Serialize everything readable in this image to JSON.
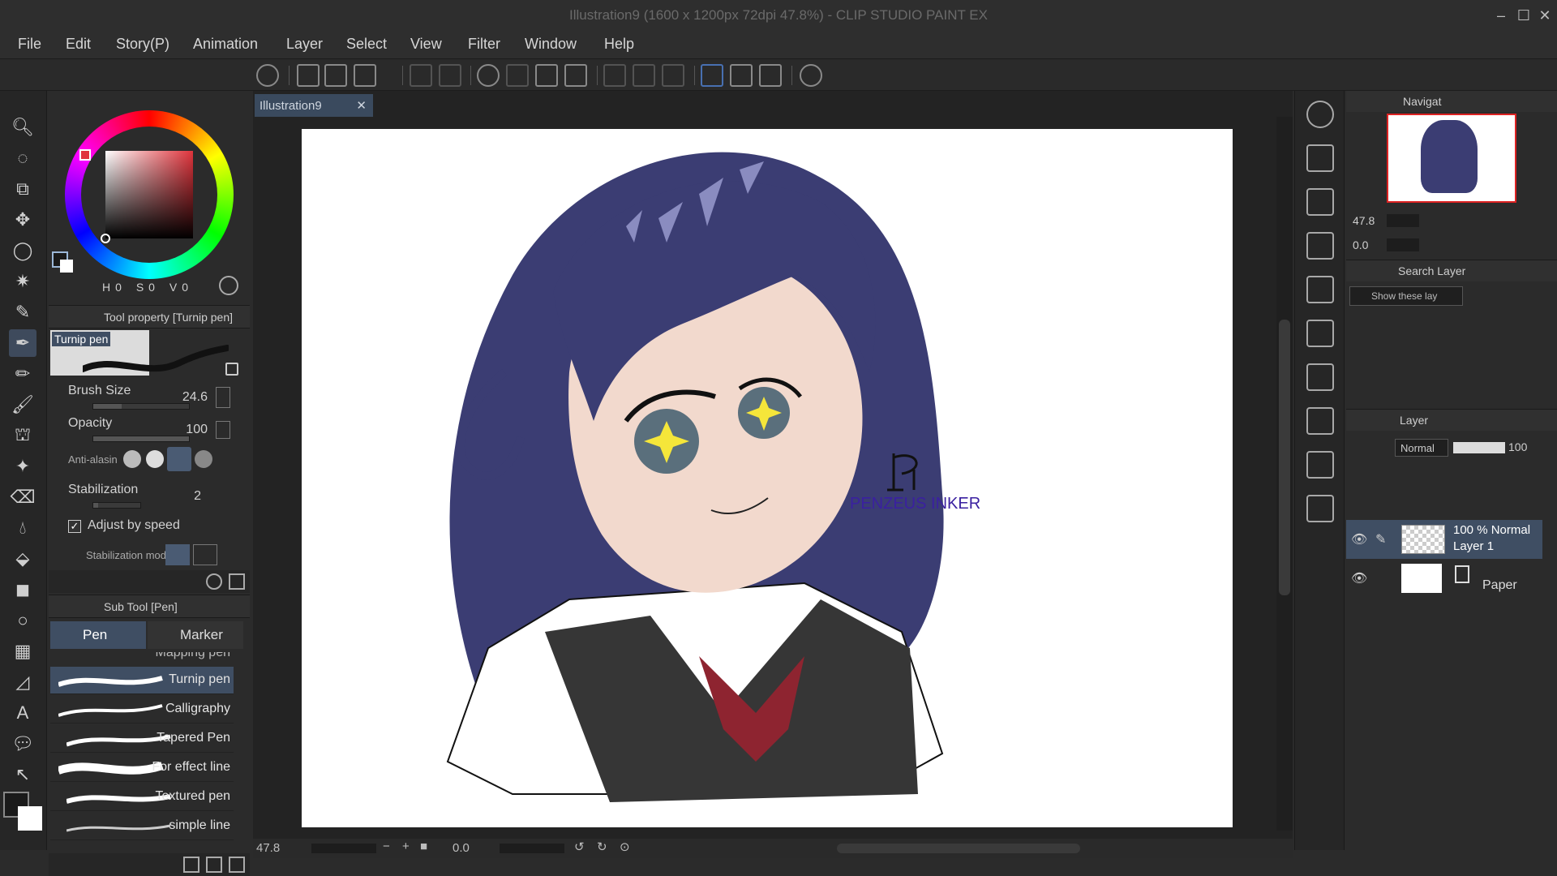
{
  "window": {
    "title": "Illustration9 (1600 x 1200px 72dpi 47.8%)  - CLIP STUDIO PAINT EX"
  },
  "menu": [
    "File",
    "Edit",
    "Story(P)",
    "Animation",
    "Layer",
    "Select",
    "View",
    "Filter",
    "Window",
    "Help"
  ],
  "color_panel": {
    "main_color": "#1a1a1a",
    "sub_color": "#ffffff",
    "picked_hue": "#e0343c",
    "readouts": [
      "0",
      "0",
      "0"
    ]
  },
  "tool_property": {
    "header": "Tool property [Turnip pen]",
    "brush_name": "Turnip pen",
    "brush_size_label": "Brush Size",
    "brush_size_value": "24.6",
    "opacity_label": "Opacity",
    "opacity_value": "100",
    "anti_alias_label": "Anti-alasin",
    "stabilization_label": "Stabilization",
    "stabilization_value": "2",
    "adjust_label": "Adjust by speed",
    "stab_mode_label": "Stabilization mod"
  },
  "sub_tool": {
    "header": "Sub Tool [Pen]",
    "tabs": [
      "Pen",
      "Marker"
    ],
    "hidden_item": "Mapping pen",
    "brushes": [
      "Turnip pen",
      "Calligraphy",
      "Tapered Pen",
      "For effect line",
      "Textured pen",
      "simple line"
    ]
  },
  "document": {
    "tab_label": "Illustration9",
    "signature_text": "PENZEUS INKER",
    "zoom": "47.8",
    "angle": "0.0"
  },
  "navigator": {
    "header": "Navigat",
    "zoom": "47.8",
    "angle": "0.0"
  },
  "search_layer": {
    "header": "Search Layer",
    "filter_placeholder": "Show these lay"
  },
  "layer_panel": {
    "header": "Layer",
    "blend_mode": "Normal",
    "opacity": "100",
    "layers": [
      {
        "info": "100 % Normal",
        "name": "Layer 1"
      },
      {
        "info": "",
        "name": "Paper"
      }
    ]
  },
  "colors": {
    "hair": "#3b3d73",
    "hair_highlight": "#8a8cc0",
    "skin": "#f2d9cd",
    "vest": "#363636",
    "tie": "#8e2430",
    "signature": "#3a20a0",
    "selection": "#3f4e63"
  }
}
